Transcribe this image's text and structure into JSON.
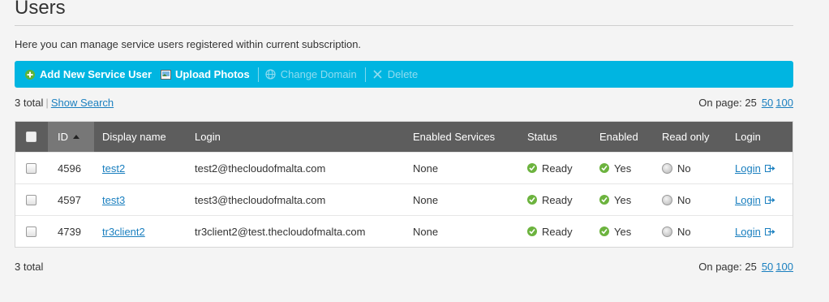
{
  "page": {
    "title": "Users",
    "intro": "Here you can manage service users registered within current subscription."
  },
  "toolbar": {
    "add_user": "Add New Service User",
    "upload_photos": "Upload Photos",
    "change_domain": "Change Domain",
    "delete": "Delete"
  },
  "summary": {
    "total": "3 total",
    "show_search": "Show Search",
    "on_page_label": "On page:",
    "page_sizes": [
      "25",
      "50",
      "100"
    ]
  },
  "table": {
    "headers": {
      "id": "ID",
      "display_name": "Display name",
      "login": "Login",
      "enabled_services": "Enabled Services",
      "status": "Status",
      "enabled": "Enabled",
      "read_only": "Read only",
      "login_action": "Login"
    },
    "rows": [
      {
        "id": "4596",
        "name": "test2",
        "login": "test2@thecloudofmalta.com",
        "services": "None",
        "status": "Ready",
        "enabled": "Yes",
        "read_only": "No",
        "login_link": "Login"
      },
      {
        "id": "4597",
        "name": "test3",
        "login": "test3@thecloudofmalta.com",
        "services": "None",
        "status": "Ready",
        "enabled": "Yes",
        "read_only": "No",
        "login_link": "Login"
      },
      {
        "id": "4739",
        "name": "tr3client2",
        "login": "tr3client2@test.thecloudofmalta.com",
        "services": "None",
        "status": "Ready",
        "enabled": "Yes",
        "read_only": "No",
        "login_link": "Login"
      }
    ]
  },
  "colors": {
    "toolbar_bg": "#00b5e1",
    "header_bg": "#5d5d5d",
    "link": "#1a7fbf",
    "ok_green": "#6cb33e"
  }
}
